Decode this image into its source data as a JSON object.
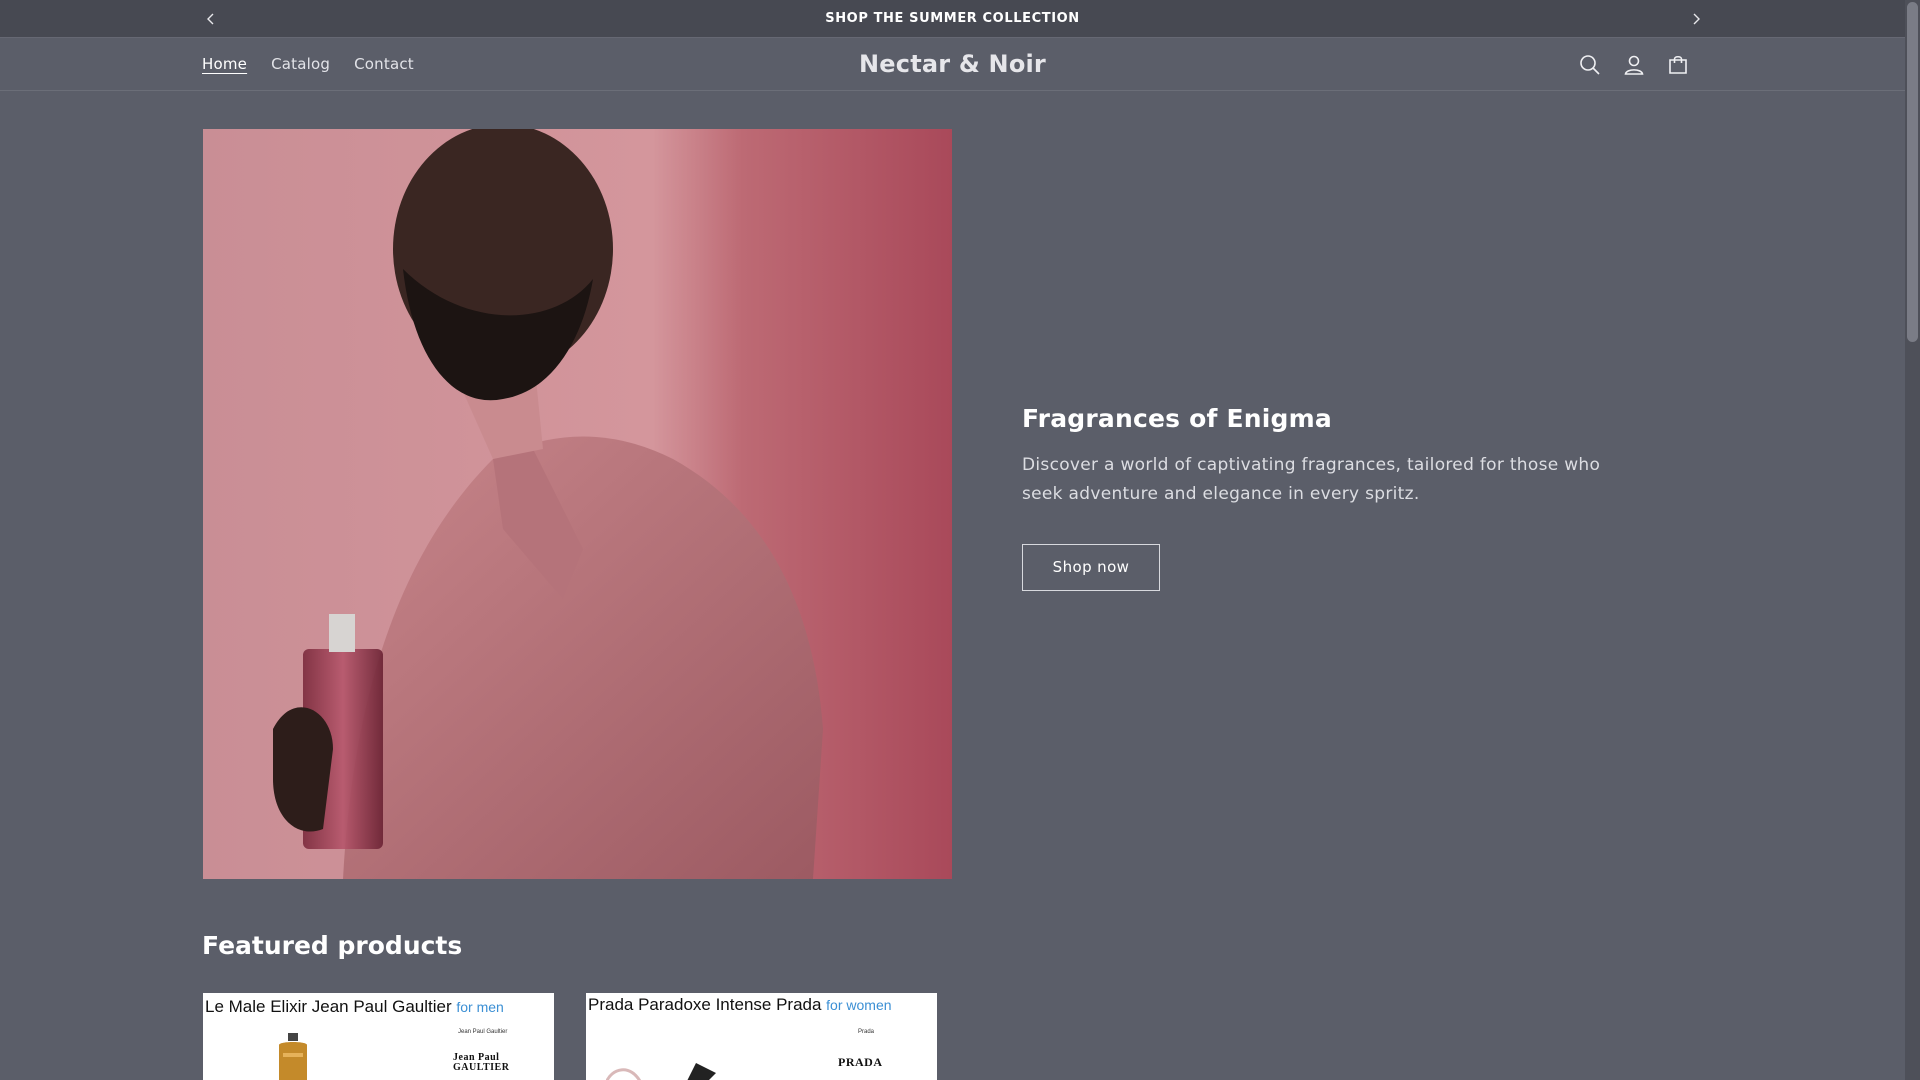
{
  "announcement": {
    "text": "SHOP THE SUMMER COLLECTION"
  },
  "header": {
    "logo": "Nectar & Noir",
    "nav": [
      {
        "label": "Home",
        "active": true
      },
      {
        "label": "Catalog",
        "active": false
      },
      {
        "label": "Contact",
        "active": false
      }
    ],
    "icons": [
      "search-icon",
      "account-icon",
      "cart-icon"
    ]
  },
  "hero": {
    "title": "Fragrances of Enigma",
    "description": "Discover a world of captivating fragrances, tailored for those who seek adventure and elegance in every spritz.",
    "button": "Shop now"
  },
  "featured": {
    "title": "Featured products",
    "products": [
      {
        "name": "Le Male Elixir Jean Paul Gaultier",
        "tag": "for men",
        "brand_small": "Jean Paul Gaultier",
        "brand": "Jean Paul GAULTIER"
      },
      {
        "name": "Prada Paradoxe Intense Prada",
        "tag": "for women",
        "brand_small": "Prada",
        "brand": "PRADA"
      }
    ]
  },
  "colors": {
    "background": "#5b5e69",
    "announcement_bar": "#474952",
    "card_tag": "#3b8fd4"
  }
}
